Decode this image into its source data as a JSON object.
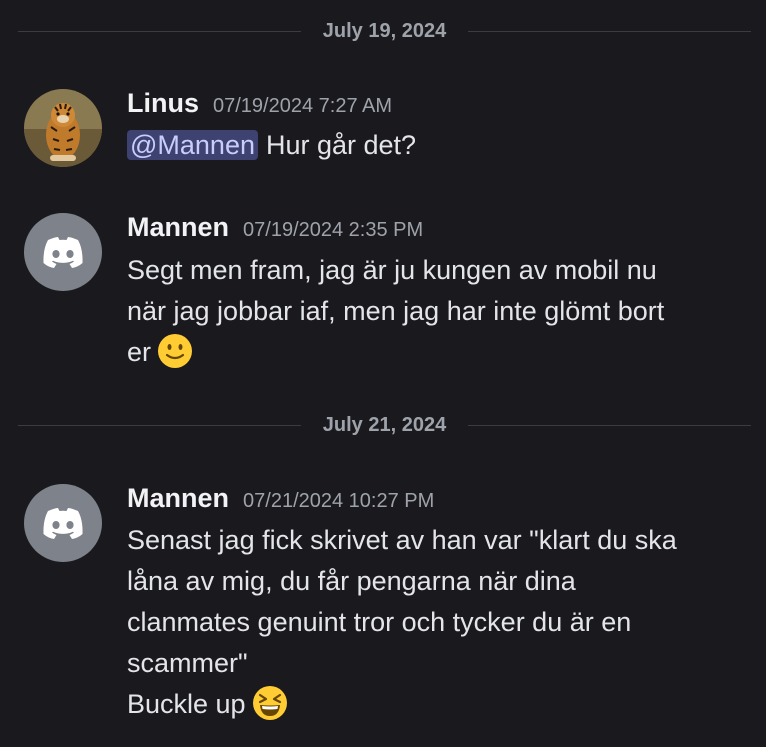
{
  "dividers": [
    {
      "date": "July 19, 2024"
    },
    {
      "date": "July 21, 2024"
    }
  ],
  "messages": [
    {
      "username": "Linus",
      "timestamp": "07/19/2024 7:27 AM",
      "avatar": "tiger-avatar",
      "mention": "@Mannen",
      "text": "Hur går det?"
    },
    {
      "username": "Mannen",
      "timestamp": "07/19/2024 2:35 PM",
      "avatar": "discord-default-avatar",
      "lines": [
        "Segt men fram, jag är ju kungen av mobil nu",
        "när jag jobbar iaf, men jag har inte glömt bort",
        "er"
      ],
      "emoji": "slightly-smiling-face"
    },
    {
      "username": "Mannen",
      "timestamp": "07/21/2024 10:27 PM",
      "avatar": "discord-default-avatar",
      "lines": [
        "Senast jag fick skrivet av han var \"klart du ska",
        "låna av mig, du får pengarna när dina",
        "clanmates genuint tror och tycker du är en",
        "scammer\"",
        "Buckle up"
      ],
      "emoji": "laughing-face"
    }
  ],
  "colors": {
    "background": "#1a1a1e",
    "mention_bg": "#3d4270",
    "mention_text": "#c9cdfb",
    "discord_avatar_bg": "#7e838b"
  }
}
